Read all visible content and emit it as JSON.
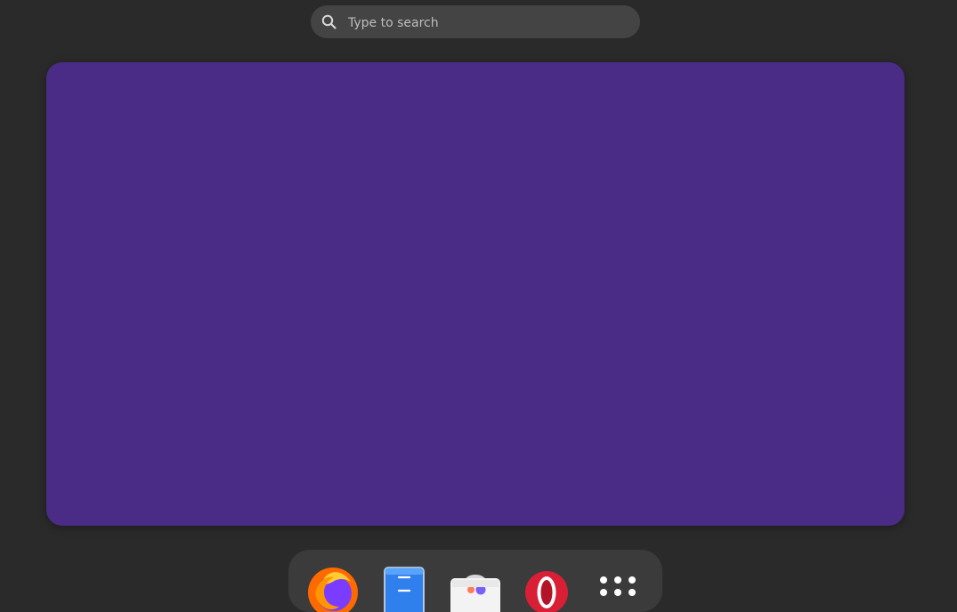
{
  "search": {
    "placeholder": "Type to search"
  },
  "workspace": {
    "background": "#4a2c86"
  },
  "dock": {
    "items": [
      {
        "name": "firefox",
        "icon": "firefox-icon"
      },
      {
        "name": "files",
        "icon": "files-icon"
      },
      {
        "name": "software",
        "icon": "software-center-icon"
      },
      {
        "name": "opera",
        "icon": "opera-icon"
      },
      {
        "name": "show-apps",
        "icon": "app-grid-icon"
      }
    ]
  }
}
